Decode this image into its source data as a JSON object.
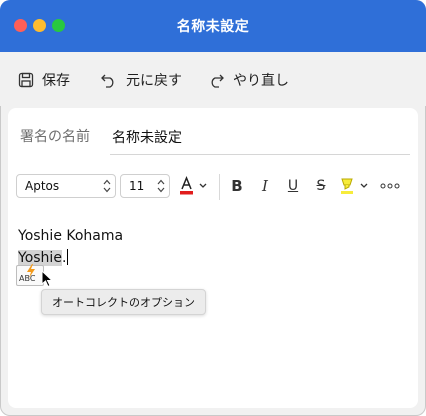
{
  "window": {
    "title": "名称未設定"
  },
  "toolbar": {
    "save_label": "保存",
    "undo_label": "元に戻す",
    "redo_label": "やり直し"
  },
  "signature": {
    "name_label": "署名の名前",
    "name_value": "名称未設定"
  },
  "format": {
    "font_name": "Aptos",
    "font_size": "11",
    "font_color": "#e11d1d",
    "highlight_color": "#f7ec3b"
  },
  "body": {
    "line1": "Yoshie Kohama",
    "line2_highlight": "Yoshie",
    "line2_rest": "."
  },
  "autocorrect": {
    "button_text": "ABC",
    "tooltip": "オートコレクトのオプション"
  }
}
